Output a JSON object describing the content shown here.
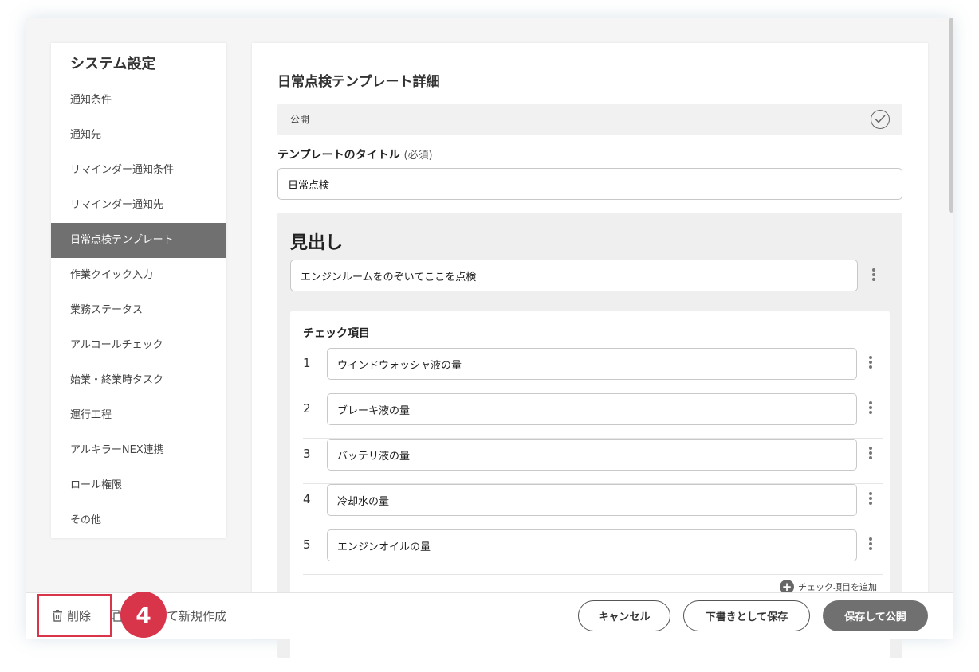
{
  "sidebar": {
    "title": "システム設定",
    "items": [
      {
        "label": "通知条件"
      },
      {
        "label": "通知先"
      },
      {
        "label": "リマインダー通知条件"
      },
      {
        "label": "リマインダー通知先"
      },
      {
        "label": "日常点検テンプレート",
        "active": true
      },
      {
        "label": "作業クイック入力"
      },
      {
        "label": "業務ステータス"
      },
      {
        "label": "アルコールチェック"
      },
      {
        "label": "始業・終業時タスク"
      },
      {
        "label": "運行工程"
      },
      {
        "label": "アルキラーNEX連携"
      },
      {
        "label": "ロール権限"
      },
      {
        "label": "その他"
      }
    ]
  },
  "main": {
    "title": "日常点検テンプレート詳細",
    "public_label": "公開",
    "template_title_label": "テンプレートのタイトル",
    "required_label": "(必須)",
    "template_title_value": "日常点検",
    "heading_label": "見出し",
    "heading_value": "エンジンルームをのぞいてここを点検",
    "check_items_title": "チェック項目",
    "check_items": [
      {
        "num": "1",
        "value": "ウインドウォッシャ液の量"
      },
      {
        "num": "2",
        "value": "ブレーキ液の量"
      },
      {
        "num": "3",
        "value": "バッテリ液の量"
      },
      {
        "num": "4",
        "value": "冷却水の量"
      },
      {
        "num": "5",
        "value": "エンジンオイルの量"
      }
    ],
    "add_check_item_label": "チェック項目を追加"
  },
  "footer": {
    "delete_label": "削除",
    "copy_new_label": "て新規作成",
    "cancel_label": "キャンセル",
    "draft_label": "下書きとして保存",
    "publish_label": "保存して公開"
  },
  "annotation": {
    "step_number": "4",
    "color": "#d8344a"
  }
}
